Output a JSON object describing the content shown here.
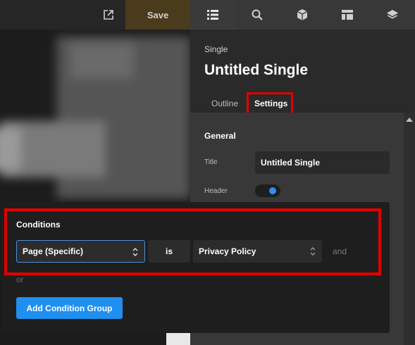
{
  "toolbar": {
    "save_label": "Save",
    "icons": [
      "external-link-icon",
      "structure-list-icon",
      "search-icon",
      "box-icon",
      "layout-icon",
      "layers-icon"
    ]
  },
  "panel": {
    "template_type": "Single",
    "title": "Untitled Single",
    "tabs": [
      {
        "label": "Outline",
        "active": false
      },
      {
        "label": "Settings",
        "active": true
      }
    ],
    "general": {
      "heading": "General",
      "title_label": "Title",
      "title_value": "Untitled Single",
      "header_label": "Header",
      "header_enabled": true
    }
  },
  "conditions": {
    "heading": "Conditions",
    "rule": {
      "type": "Page (Specific)",
      "operator": "is",
      "value": "Privacy Policy"
    },
    "and_label": "and",
    "or_label": "or",
    "add_group_label": "Add Condition Group"
  },
  "colors": {
    "accent": "#1f8ff0",
    "save": "#e8b84a",
    "highlight": "#e00000"
  }
}
